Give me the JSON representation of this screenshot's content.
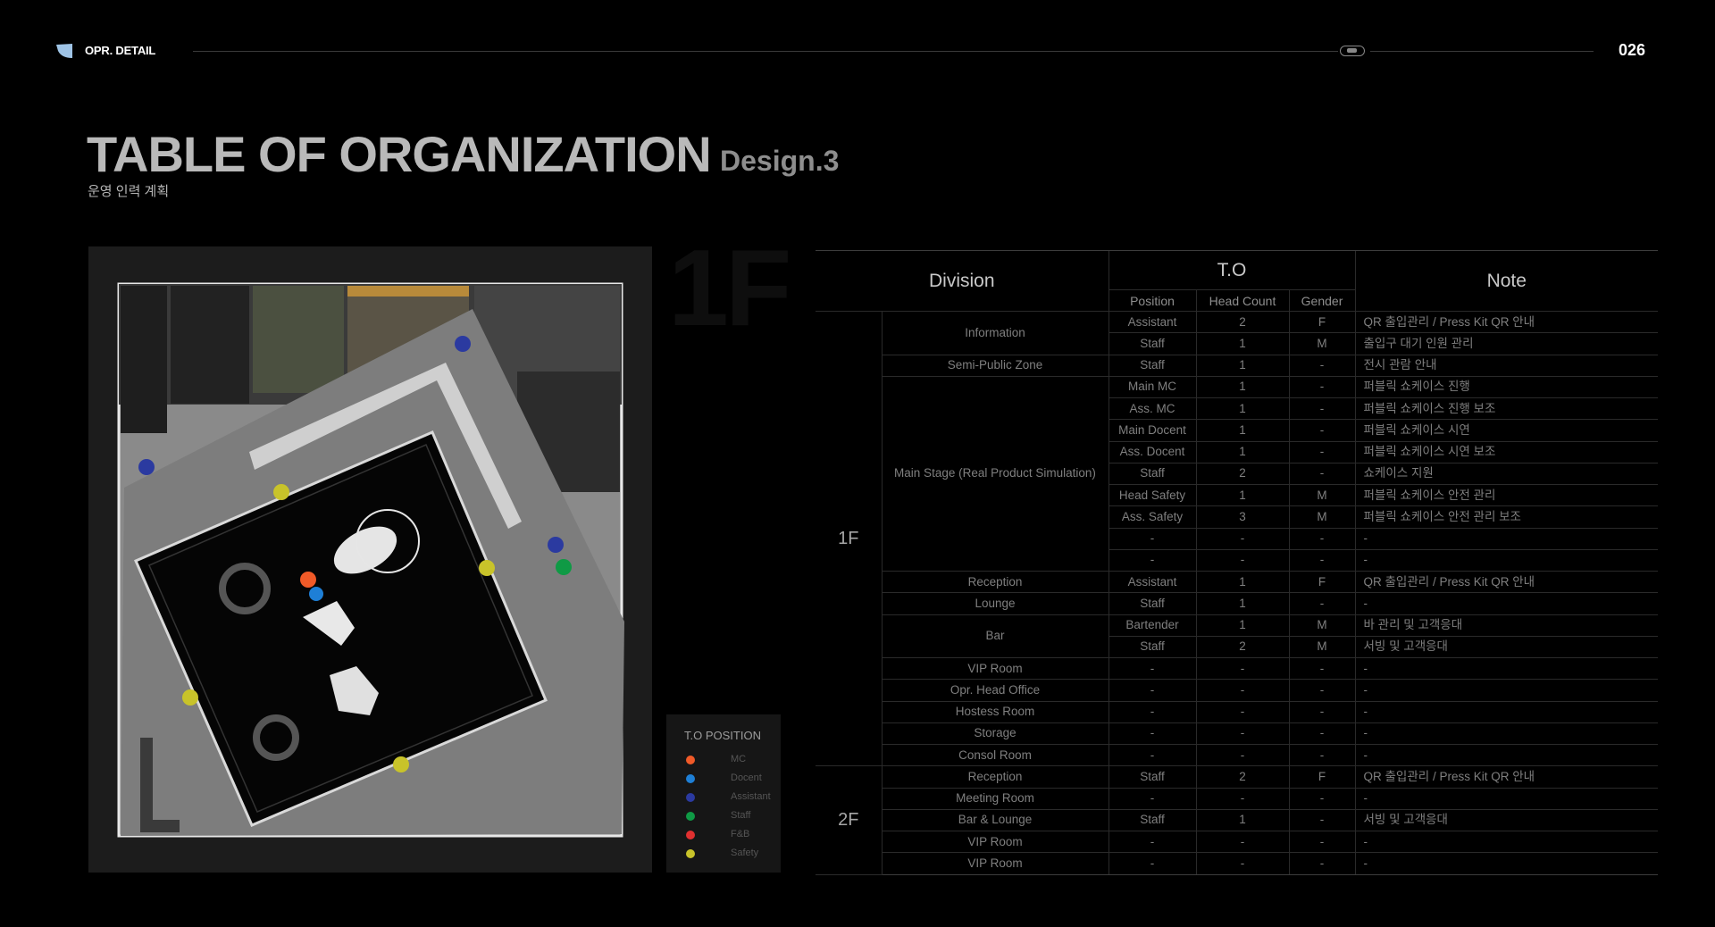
{
  "header": {
    "section": "OPR. DETAIL",
    "page_number": "026"
  },
  "title": {
    "main": "TABLE OF ORGANIZATION",
    "design": "Design.3",
    "subtitle_kr": "운영 인력 계획"
  },
  "floor_watermark": "1F",
  "legend": {
    "title": "T.O POSITION",
    "items": [
      {
        "label": "MC",
        "color": "#f05a28"
      },
      {
        "label": "Docent",
        "color": "#1e7fd6"
      },
      {
        "label": "Assistant",
        "color": "#2b3aa0"
      },
      {
        "label": "Staff",
        "color": "#0f9a45"
      },
      {
        "label": "F&B",
        "color": "#e03030"
      },
      {
        "label": "Safety",
        "color": "#c8c32a"
      }
    ]
  },
  "table": {
    "headers": {
      "division": "Division",
      "to": "T.O",
      "note": "Note",
      "position": "Position",
      "head_count": "Head Count",
      "gender": "Gender"
    },
    "floors": {
      "f1": "1F",
      "f2": "2F"
    },
    "zones": {
      "information": "Information",
      "semi_public": "Semi-Public Zone",
      "main_stage": "Main Stage",
      "main_stage_sub": "(Real Product Simulation)",
      "reception": "Reception",
      "lounge": "Lounge",
      "bar": "Bar",
      "vip_room": "VIP Room",
      "opr_head_office": "Opr. Head Office",
      "hostess_room": "Hostess Room",
      "storage": "Storage",
      "consol_room": "Consol Room",
      "reception2": "Reception",
      "meeting_room": "Meeting Room",
      "bar_lounge": "Bar & Lounge",
      "vip_room2": "VIP Room",
      "vip_room3": "VIP Room"
    },
    "rows": [
      {
        "position": "Assistant",
        "count": "2",
        "gender": "F",
        "note": "QR 출입관리 / Press Kit QR 안내"
      },
      {
        "position": "Staff",
        "count": "1",
        "gender": "M",
        "note": "출입구 대기 인원 관리"
      },
      {
        "position": "Staff",
        "count": "1",
        "gender": "-",
        "note": "전시 관람 안내"
      },
      {
        "position": "Main MC",
        "count": "1",
        "gender": "-",
        "note": "퍼블릭 쇼케이스 진행"
      },
      {
        "position": "Ass. MC",
        "count": "1",
        "gender": "-",
        "note": "퍼블릭 쇼케이스 진행 보조"
      },
      {
        "position": "Main Docent",
        "count": "1",
        "gender": "-",
        "note": "퍼블릭 쇼케이스 시연"
      },
      {
        "position": "Ass. Docent",
        "count": "1",
        "gender": "-",
        "note": "퍼블릭 쇼케이스 시연 보조"
      },
      {
        "position": "Staff",
        "count": "2",
        "gender": "-",
        "note": "쇼케이스 지원"
      },
      {
        "position": "Head Safety",
        "count": "1",
        "gender": "M",
        "note": "퍼블릭 쇼케이스 안전 관리"
      },
      {
        "position": "Ass. Safety",
        "count": "3",
        "gender": "M",
        "note": "퍼블릭 쇼케이스 안전 관리 보조"
      },
      {
        "position": "-",
        "count": "-",
        "gender": "-",
        "note": "-"
      },
      {
        "position": "-",
        "count": "-",
        "gender": "-",
        "note": "-"
      },
      {
        "position": "Assistant",
        "count": "1",
        "gender": "F",
        "note": "QR 출입관리 / Press Kit QR 안내"
      },
      {
        "position": "Staff",
        "count": "1",
        "gender": "-",
        "note": "-"
      },
      {
        "position": "Bartender",
        "count": "1",
        "gender": "M",
        "note": "바 관리 및  고객응대"
      },
      {
        "position": "Staff",
        "count": "2",
        "gender": "M",
        "note": "서빙 및 고객응대"
      },
      {
        "position": "-",
        "count": "-",
        "gender": "-",
        "note": "-"
      },
      {
        "position": "-",
        "count": "-",
        "gender": "-",
        "note": "-"
      },
      {
        "position": "-",
        "count": "-",
        "gender": "-",
        "note": "-"
      },
      {
        "position": "-",
        "count": "-",
        "gender": "-",
        "note": "-"
      },
      {
        "position": "-",
        "count": "-",
        "gender": "-",
        "note": "-"
      },
      {
        "position": "Staff",
        "count": "2",
        "gender": "F",
        "note": "QR 출입관리 / Press Kit QR 안내"
      },
      {
        "position": "-",
        "count": "-",
        "gender": "-",
        "note": "-"
      },
      {
        "position": "Staff",
        "count": "1",
        "gender": "-",
        "note": "서빙 및 고객응대"
      },
      {
        "position": "-",
        "count": "-",
        "gender": "-",
        "note": "-"
      },
      {
        "position": "-",
        "count": "-",
        "gender": "-",
        "note": "-"
      }
    ]
  }
}
